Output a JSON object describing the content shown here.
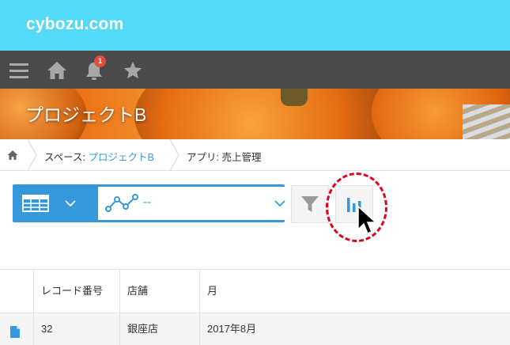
{
  "header": {
    "brand": "cybozu.com",
    "brand_color": "#54d9f6"
  },
  "nav": {
    "menu_icon": "hamburger-icon",
    "home_icon": "home-icon",
    "notification_icon": "bell-icon",
    "notification_count": "1",
    "favorites_icon": "star-icon"
  },
  "space": {
    "title": "プロジェクトB"
  },
  "breadcrumb": {
    "home_icon": "home-icon",
    "space_prefix": "スペース: ",
    "space_name": "プロジェクトB",
    "app_label": "アプリ: 売上管理"
  },
  "toolbar": {
    "view_icon": "table-view-icon",
    "graph_icon": "line-graph-icon",
    "graph_selected": "--",
    "filter_icon": "filter-icon",
    "chart_icon": "bar-chart-icon",
    "accent_color": "#3498db",
    "highlight_color": "#e0001b"
  },
  "table": {
    "headers": [
      "レコード番号",
      "店舗",
      "月"
    ],
    "rows": [
      {
        "icon": "document-icon",
        "record_number": "32",
        "store": "銀座店",
        "month": "2017年8月"
      }
    ]
  }
}
